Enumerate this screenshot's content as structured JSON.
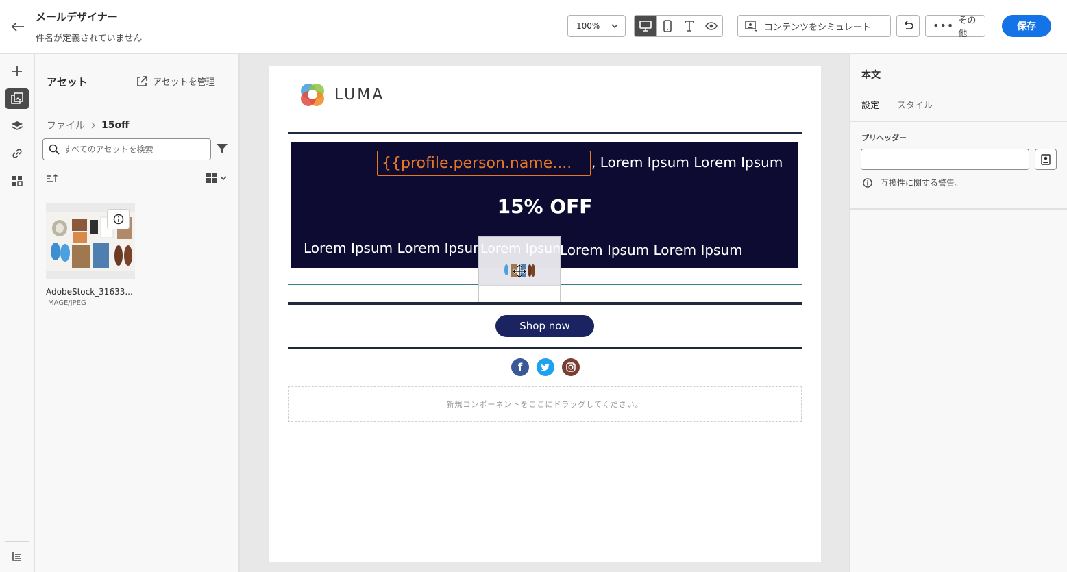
{
  "header": {
    "title": "メールデザイナー",
    "subtitle": "件名が定義されていません",
    "zoom": "100%",
    "simulate_label": "コンテンツをシミュレート",
    "more_label": "その他",
    "save_label": "保存",
    "view_modes": [
      "desktop-icon",
      "mobile-icon",
      "text-icon",
      "eye-icon"
    ],
    "active_view": "desktop"
  },
  "rail": {
    "items": [
      "plus-icon",
      "assets-icon",
      "layers-icon",
      "link-icon",
      "fragments-icon",
      "history-icon"
    ],
    "active": "assets"
  },
  "assets": {
    "title": "アセット",
    "manage_label": "アセットを管理",
    "breadcrumb": {
      "root": "ファイル",
      "current": "15off"
    },
    "search_placeholder": "すべてのアセットを検索",
    "items": [
      {
        "name": "AdobeStock_31633...",
        "type": "IMAGE/JPEG"
      }
    ]
  },
  "email": {
    "logo_text": "LUMA",
    "personalization_token": "{{profile.person.name....",
    "greeting_rest": ", Lorem Ipsum Lorem Ipsum",
    "offer": "15% OFF",
    "body_left": "Lorem Ipsum Lorem Ipsum",
    "ghost_text": "Lorem Ipsum",
    "body_right": "Lorem Ipsum Lorem Ipsum",
    "cta": "Shop now",
    "socials": [
      "facebook-icon",
      "twitter-icon",
      "instagram-icon"
    ],
    "drop_zone": "新規コンポーネントをここにドラッグしてください。"
  },
  "props": {
    "title": "本文",
    "tabs": [
      "設定",
      "スタイル"
    ],
    "active_tab": "設定",
    "preheader_label": "プリヘッダー",
    "preheader_value": "",
    "warning": "互換性に関する警告。"
  },
  "colors": {
    "accent": "#1473e6",
    "banner_bg": "#0e0b33",
    "token_orange": "#e87722",
    "cta_bg": "#1b2461"
  }
}
